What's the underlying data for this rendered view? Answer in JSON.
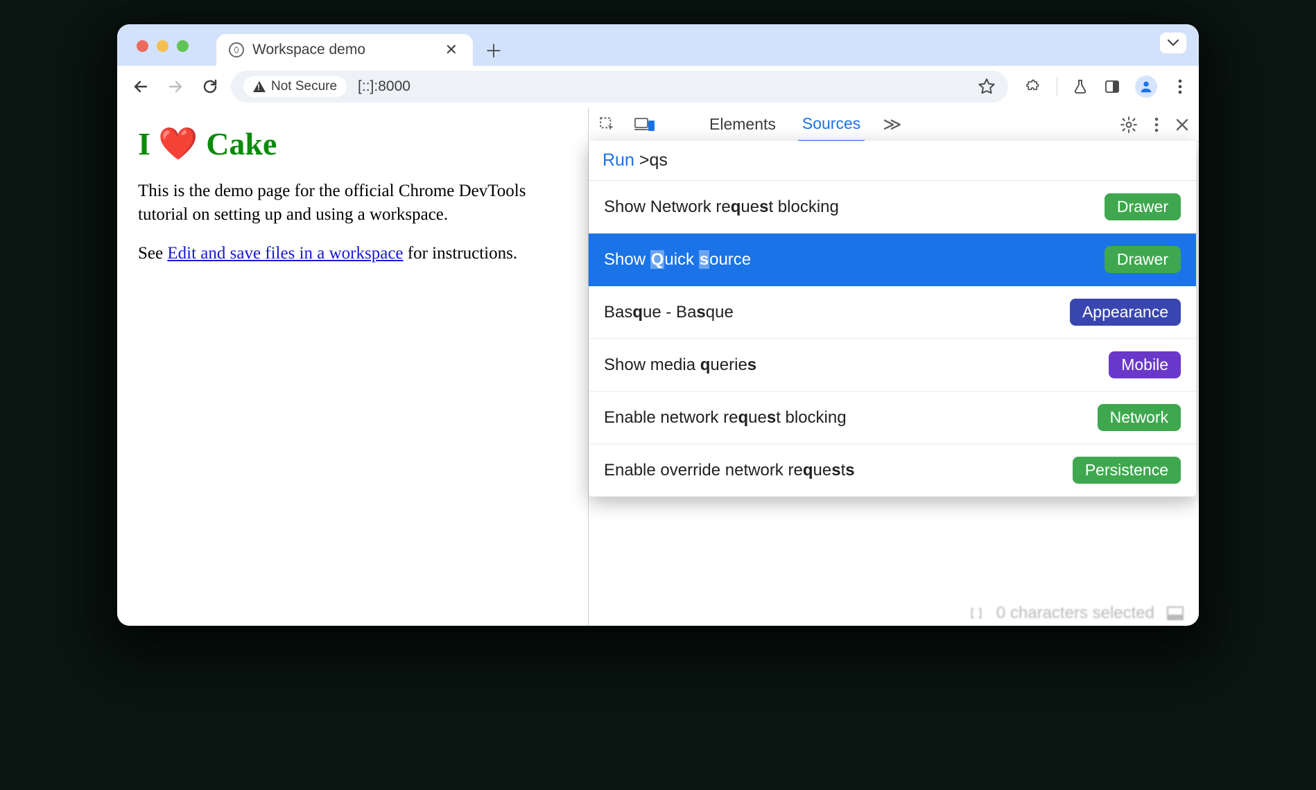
{
  "tab": {
    "title": "Workspace demo"
  },
  "address": {
    "not_secure": "Not Secure",
    "url": "[::]:8000"
  },
  "page": {
    "heading_prefix": "I ",
    "heading_heart": "❤️",
    "heading_suffix": " Cake",
    "paragraph1": "This is the demo page for the official Chrome DevTools tutorial on setting up and using a workspace.",
    "paragraph2_prefix": "See ",
    "paragraph2_link": "Edit and save files in a workspace",
    "paragraph2_suffix": " for instructions."
  },
  "devtools": {
    "tabs": {
      "elements": "Elements",
      "sources": "Sources"
    },
    "command_menu": {
      "run_label": "Run",
      "query_prefix": ">",
      "query": "qs",
      "items": [
        {
          "label_html": "Show Network re<b>q</b>ue<b>s</b>t blocking",
          "badge": "Drawer",
          "badge_color": "green",
          "selected": false
        },
        {
          "label_html": "Show <span class='hili'><b>Q</b></span>uick <span class='hili'><b>s</b></span>ource",
          "badge": "Drawer",
          "badge_color": "green",
          "selected": true
        },
        {
          "label_html": "Bas<b>q</b>ue - Ba<b>s</b>que",
          "badge": "Appearance",
          "badge_color": "indigo",
          "selected": false
        },
        {
          "label_html": "Show media <b>q</b>uerie<b>s</b>",
          "badge": "Mobile",
          "badge_color": "purple",
          "selected": false
        },
        {
          "label_html": "Enable network re<b>q</b>ue<b>s</b>t blocking",
          "badge": "Network",
          "badge_color": "green",
          "selected": false
        },
        {
          "label_html": "Enable override network re<b>q</b>ue<b>s</b>t<b>s</b>",
          "badge": "Persistence",
          "badge_color": "green",
          "selected": false
        }
      ]
    },
    "footer_text": "0 characters selected"
  }
}
